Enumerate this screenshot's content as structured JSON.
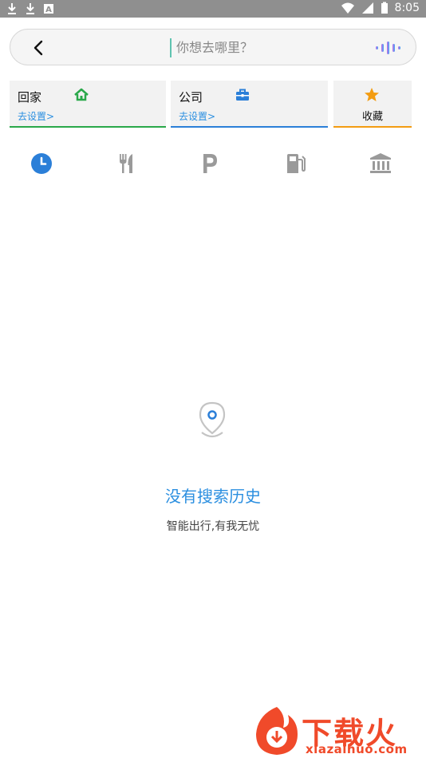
{
  "status_bar": {
    "time": "8:05",
    "icons": [
      "download-icon",
      "download-icon",
      "a-icon",
      "wifi-icon",
      "signal-icon",
      "battery-icon"
    ]
  },
  "search": {
    "placeholder": "你想去哪里？",
    "back_icon": "chevron-left-icon",
    "voice_icon": "voice-wave-icon"
  },
  "shortcuts": {
    "home": {
      "label": "回家",
      "action": "去设置>",
      "icon": "home-icon",
      "color": "#2aa84a"
    },
    "work": {
      "label": "公司",
      "action": "去设置>",
      "icon": "briefcase-icon",
      "color": "#2b7fd8"
    },
    "favorites": {
      "label": "收藏",
      "icon": "star-icon",
      "color": "#f39c12"
    }
  },
  "categories": [
    {
      "icon": "clock-icon",
      "active": true
    },
    {
      "icon": "restaurant-icon",
      "active": false
    },
    {
      "icon": "parking-icon",
      "active": false
    },
    {
      "icon": "gas-station-icon",
      "active": false
    },
    {
      "icon": "bank-icon",
      "active": false
    }
  ],
  "empty_state": {
    "icon": "location-pin-icon",
    "title": "没有搜索历史",
    "subtitle": "智能出行,有我无忧"
  },
  "watermark": {
    "brand": "下载火",
    "url": "xiazaihuo.com"
  }
}
